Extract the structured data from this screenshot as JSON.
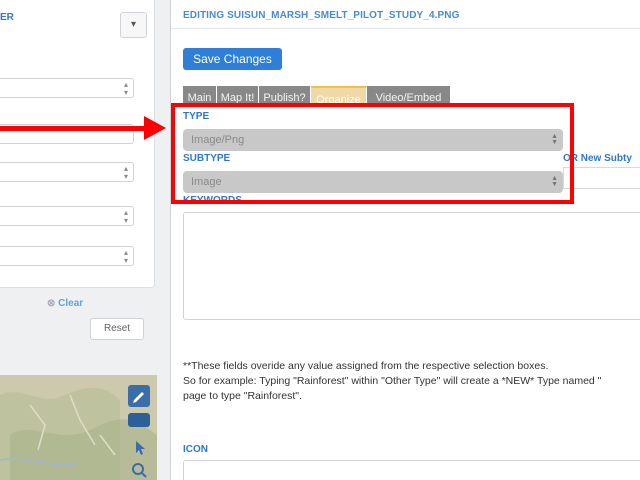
{
  "sidebar": {
    "header_label": "ER",
    "header_toggle": "▾",
    "clear_label": "Clear",
    "reset_label": "Reset"
  },
  "map": {
    "controls": [
      "edit-icon",
      "layer-icon",
      "pointer-icon",
      "search-icon"
    ]
  },
  "editor": {
    "title": "EDITING SUISUN_MARSH_SMELT_PILOT_STUDY_4.PNG",
    "save_label": "Save Changes",
    "tabs": [
      {
        "label": "Main",
        "active": false
      },
      {
        "label": "Map It!",
        "active": false
      },
      {
        "label": "Publish?",
        "active": false
      },
      {
        "label": "Organize",
        "active": true
      },
      {
        "label": "Video/Embed",
        "active": false
      }
    ],
    "type_label": "TYPE",
    "type_value": "Image/Png",
    "subtype_label": "SUBTYPE",
    "subtype_value": "Image",
    "new_subtype_label": "OR New Subty",
    "keywords_label": "KEYWORDS",
    "note_line1": "**These fields overide any value assigned from the respective selection boxes.",
    "note_line2": "So for example: Typing \"Rainforest\" within \"Other Type\" will create a *NEW* Type named \"",
    "note_line3": "page to type \"Rainforest\".",
    "icon_label": "ICON"
  },
  "annotation": {
    "color": "#ff0000"
  },
  "colors": {
    "accent": "#2f7fd8",
    "label": "#2f78c8",
    "tab_gray": "#888888"
  }
}
